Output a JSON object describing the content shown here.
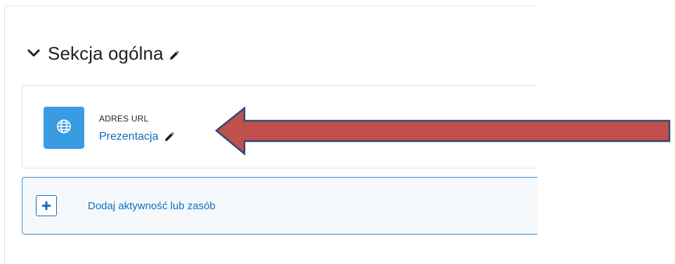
{
  "section": {
    "title": "Sekcja ogólna",
    "chevron_icon": "chevron-down-icon",
    "edit_icon": "pencil-icon"
  },
  "activity": {
    "type_label": "ADRES URL",
    "name": "Prezentacja",
    "icon": "globe-icon",
    "icon_bg": "#399be2",
    "edit_icon": "pencil-icon"
  },
  "add_activity": {
    "label": "Dodaj aktywność lub zasób",
    "icon": "plus-icon"
  },
  "annotation": {
    "arrow_fill": "#c0504d",
    "arrow_stroke": "#2f4a78",
    "direction": "left"
  },
  "colors": {
    "link": "#0f6cbf",
    "text": "#1d2125",
    "border": "#dee2e6"
  }
}
